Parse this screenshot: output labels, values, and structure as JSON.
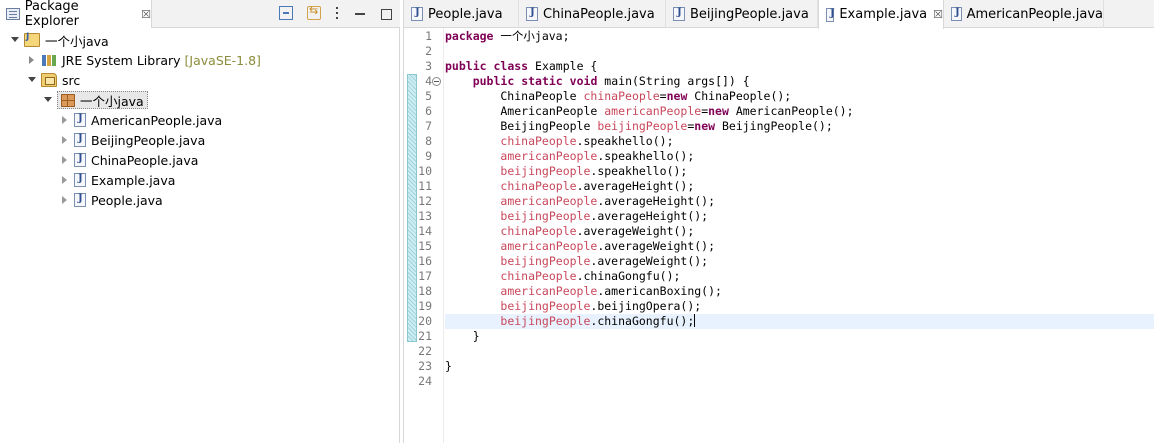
{
  "explorer": {
    "title": "Package Explorer",
    "close_glyph": "☒",
    "tree": [
      {
        "label": "一个小java",
        "icon": "java-project-icon",
        "expanded": true,
        "level": 0
      },
      {
        "label": "JRE System Library",
        "suffix": "[JavaSE-1.8]",
        "icon": "library-icon",
        "expanded": false,
        "level": 1
      },
      {
        "label": "src",
        "icon": "source-folder-icon",
        "expanded": true,
        "level": 1
      },
      {
        "label": "一个小java",
        "icon": "package-icon",
        "expanded": true,
        "level": 2,
        "selected": true
      },
      {
        "label": "AmericanPeople.java",
        "icon": "java-file-icon",
        "level": 3
      },
      {
        "label": "BeijingPeople.java",
        "icon": "java-file-icon",
        "level": 3
      },
      {
        "label": "ChinaPeople.java",
        "icon": "java-file-icon",
        "level": 3
      },
      {
        "label": "Example.java",
        "icon": "java-file-icon",
        "level": 3
      },
      {
        "label": "People.java",
        "icon": "java-file-icon",
        "level": 3
      }
    ]
  },
  "editor": {
    "tabs": [
      {
        "label": "People.java",
        "active": false
      },
      {
        "label": "ChinaPeople.java",
        "active": false
      },
      {
        "label": "BeijingPeople.java",
        "active": false
      },
      {
        "label": "Example.java",
        "active": true,
        "close_glyph": "☒"
      },
      {
        "label": "AmericanPeople.java",
        "active": false
      }
    ],
    "current_line": 20,
    "lines": [
      {
        "n": "1",
        "segs": [
          [
            "kw",
            "package"
          ],
          [
            "ty",
            " 一个小java;"
          ]
        ]
      },
      {
        "n": "2",
        "segs": []
      },
      {
        "n": "3",
        "segs": [
          [
            "kw",
            "public"
          ],
          [
            "ty",
            " "
          ],
          [
            "kw",
            "class"
          ],
          [
            "ty",
            " Example {"
          ]
        ]
      },
      {
        "n": "4",
        "segs": [
          [
            "ty",
            "    "
          ],
          [
            "kw",
            "public"
          ],
          [
            "ty",
            " "
          ],
          [
            "kw",
            "static"
          ],
          [
            "ty",
            " "
          ],
          [
            "kw",
            "void"
          ],
          [
            "ty",
            " main(String args[]) {"
          ]
        ]
      },
      {
        "n": "5",
        "segs": [
          [
            "ty",
            "        ChinaPeople "
          ],
          [
            "fld",
            "chinaPeople"
          ],
          [
            "ty",
            "="
          ],
          [
            "kw",
            "new"
          ],
          [
            "ty",
            " ChinaPeople();"
          ]
        ]
      },
      {
        "n": "6",
        "segs": [
          [
            "ty",
            "        AmericanPeople "
          ],
          [
            "fld",
            "americanPeople"
          ],
          [
            "ty",
            "="
          ],
          [
            "kw",
            "new"
          ],
          [
            "ty",
            " AmericanPeople();"
          ]
        ]
      },
      {
        "n": "7",
        "segs": [
          [
            "ty",
            "        BeijingPeople "
          ],
          [
            "fld",
            "beijingPeople"
          ],
          [
            "ty",
            "="
          ],
          [
            "kw",
            "new"
          ],
          [
            "ty",
            " BeijingPeople();"
          ]
        ]
      },
      {
        "n": "8",
        "segs": [
          [
            "ty",
            "        "
          ],
          [
            "fld",
            "chinaPeople"
          ],
          [
            "ty",
            ".speakhello();"
          ]
        ]
      },
      {
        "n": "9",
        "segs": [
          [
            "ty",
            "        "
          ],
          [
            "fld",
            "americanPeople"
          ],
          [
            "ty",
            ".speakhello();"
          ]
        ]
      },
      {
        "n": "10",
        "segs": [
          [
            "ty",
            "        "
          ],
          [
            "fld",
            "beijingPeople"
          ],
          [
            "ty",
            ".speakhello();"
          ]
        ]
      },
      {
        "n": "11",
        "segs": [
          [
            "ty",
            "        "
          ],
          [
            "fld",
            "chinaPeople"
          ],
          [
            "ty",
            ".averageHeight();"
          ]
        ]
      },
      {
        "n": "12",
        "segs": [
          [
            "ty",
            "        "
          ],
          [
            "fld",
            "americanPeople"
          ],
          [
            "ty",
            ".averageHeight();"
          ]
        ]
      },
      {
        "n": "13",
        "segs": [
          [
            "ty",
            "        "
          ],
          [
            "fld",
            "beijingPeople"
          ],
          [
            "ty",
            ".averageHeight();"
          ]
        ]
      },
      {
        "n": "14",
        "segs": [
          [
            "ty",
            "        "
          ],
          [
            "fld",
            "chinaPeople"
          ],
          [
            "ty",
            ".averageWeight();"
          ]
        ]
      },
      {
        "n": "15",
        "segs": [
          [
            "ty",
            "        "
          ],
          [
            "fld",
            "americanPeople"
          ],
          [
            "ty",
            ".averageWeight();"
          ]
        ]
      },
      {
        "n": "16",
        "segs": [
          [
            "ty",
            "        "
          ],
          [
            "fld",
            "beijingPeople"
          ],
          [
            "ty",
            ".averageWeight();"
          ]
        ]
      },
      {
        "n": "17",
        "segs": [
          [
            "ty",
            "        "
          ],
          [
            "fld",
            "chinaPeople"
          ],
          [
            "ty",
            ".chinaGongfu();"
          ]
        ]
      },
      {
        "n": "18",
        "segs": [
          [
            "ty",
            "        "
          ],
          [
            "fld",
            "americanPeople"
          ],
          [
            "ty",
            ".americanBoxing();"
          ]
        ]
      },
      {
        "n": "19",
        "segs": [
          [
            "ty",
            "        "
          ],
          [
            "fld",
            "beijingPeople"
          ],
          [
            "ty",
            ".beijingOpera();"
          ]
        ]
      },
      {
        "n": "20",
        "segs": [
          [
            "ty",
            "        "
          ],
          [
            "fld",
            "beijingPeople"
          ],
          [
            "ty",
            ".chinaGongfu();"
          ]
        ]
      },
      {
        "n": "21",
        "segs": [
          [
            "ty",
            "    }"
          ]
        ]
      },
      {
        "n": "22",
        "segs": []
      },
      {
        "n": "23",
        "segs": [
          [
            "ty",
            "}"
          ]
        ]
      },
      {
        "n": "24",
        "segs": []
      }
    ]
  }
}
